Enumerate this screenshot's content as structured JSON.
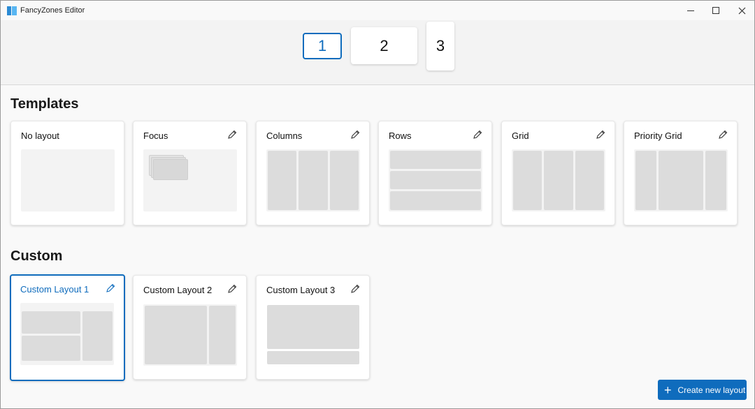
{
  "window": {
    "title": "FancyZones Editor"
  },
  "monitors": [
    "1",
    "2",
    "3"
  ],
  "sections": {
    "templates": "Templates",
    "custom": "Custom"
  },
  "templates": [
    {
      "name": "No layout",
      "editable": false
    },
    {
      "name": "Focus",
      "editable": true
    },
    {
      "name": "Columns",
      "editable": true
    },
    {
      "name": "Rows",
      "editable": true
    },
    {
      "name": "Grid",
      "editable": true
    },
    {
      "name": "Priority Grid",
      "editable": true
    }
  ],
  "custom": [
    {
      "name": "Custom Layout 1",
      "selected": true
    },
    {
      "name": "Custom Layout 2",
      "selected": false
    },
    {
      "name": "Custom Layout 3",
      "selected": false
    }
  ],
  "actions": {
    "create_new_layout": "Create new layout"
  },
  "colors": {
    "accent": "#0f6cbd",
    "zone": "#dcdcdc",
    "preview_bg": "#f3f3f3"
  },
  "icons": {
    "edit": "pencil-icon",
    "add": "plus-icon"
  }
}
